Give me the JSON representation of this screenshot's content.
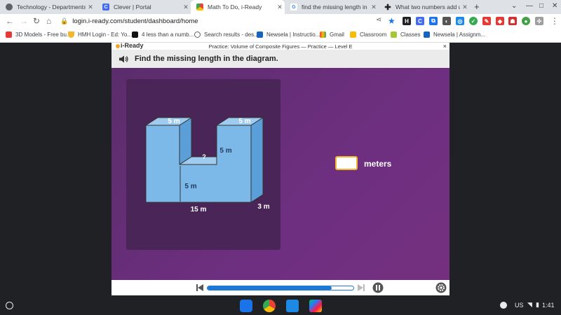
{
  "tabs": [
    {
      "title": "Technology - Departments - H",
      "icon": "globe-icon",
      "color": "#5f6368"
    },
    {
      "title": "Clever | Portal",
      "icon": "clever-icon",
      "color": "#436cf2"
    },
    {
      "title": "Math To Do, i-Ready",
      "icon": "chrome-icon",
      "color": "#f5a623"
    },
    {
      "title": "find the missing length in the",
      "icon": "google-icon",
      "color": "#4285f4"
    },
    {
      "title": "What two numbers add up to",
      "icon": "brainly-icon",
      "color": "#222222"
    }
  ],
  "toolbar": {
    "url": "login.i-ready.com/student/dashboard/home"
  },
  "bookmarks": [
    {
      "label": "3D Models - Free bu...",
      "color": "#e53935"
    },
    {
      "label": "HMH Login - Ed: Yo...",
      "color": "#f5b52e"
    },
    {
      "label": "4 less than a numb...",
      "color": "#111111"
    },
    {
      "label": "Search results - des...",
      "color": "#5f6368"
    },
    {
      "label": "Newsela | Instructio...",
      "color": "#1565c0"
    },
    {
      "label": "Gmail",
      "color": "#ea4335"
    },
    {
      "label": "Classroom",
      "color": "#f9bc05"
    },
    {
      "label": "Classes",
      "color": "#a4c639"
    },
    {
      "label": "Newsela | Assignm...",
      "color": "#1565c0"
    }
  ],
  "app": {
    "logo": "i-Ready",
    "practice_title": "Practice: Volume of Composite Figures — Practice — Level E",
    "close": "×",
    "question": "Find the missing length in the diagram.",
    "unit": "meters",
    "progress_fraction": 0.85
  },
  "diagram": {
    "top_left": "5 m",
    "top_right": "5 m",
    "unknown": "?",
    "inner_height": "5 m",
    "left_height": "5 m",
    "length": "15 m",
    "depth": "3 m"
  },
  "shelf": {
    "locale": "US",
    "time": "1:41"
  }
}
